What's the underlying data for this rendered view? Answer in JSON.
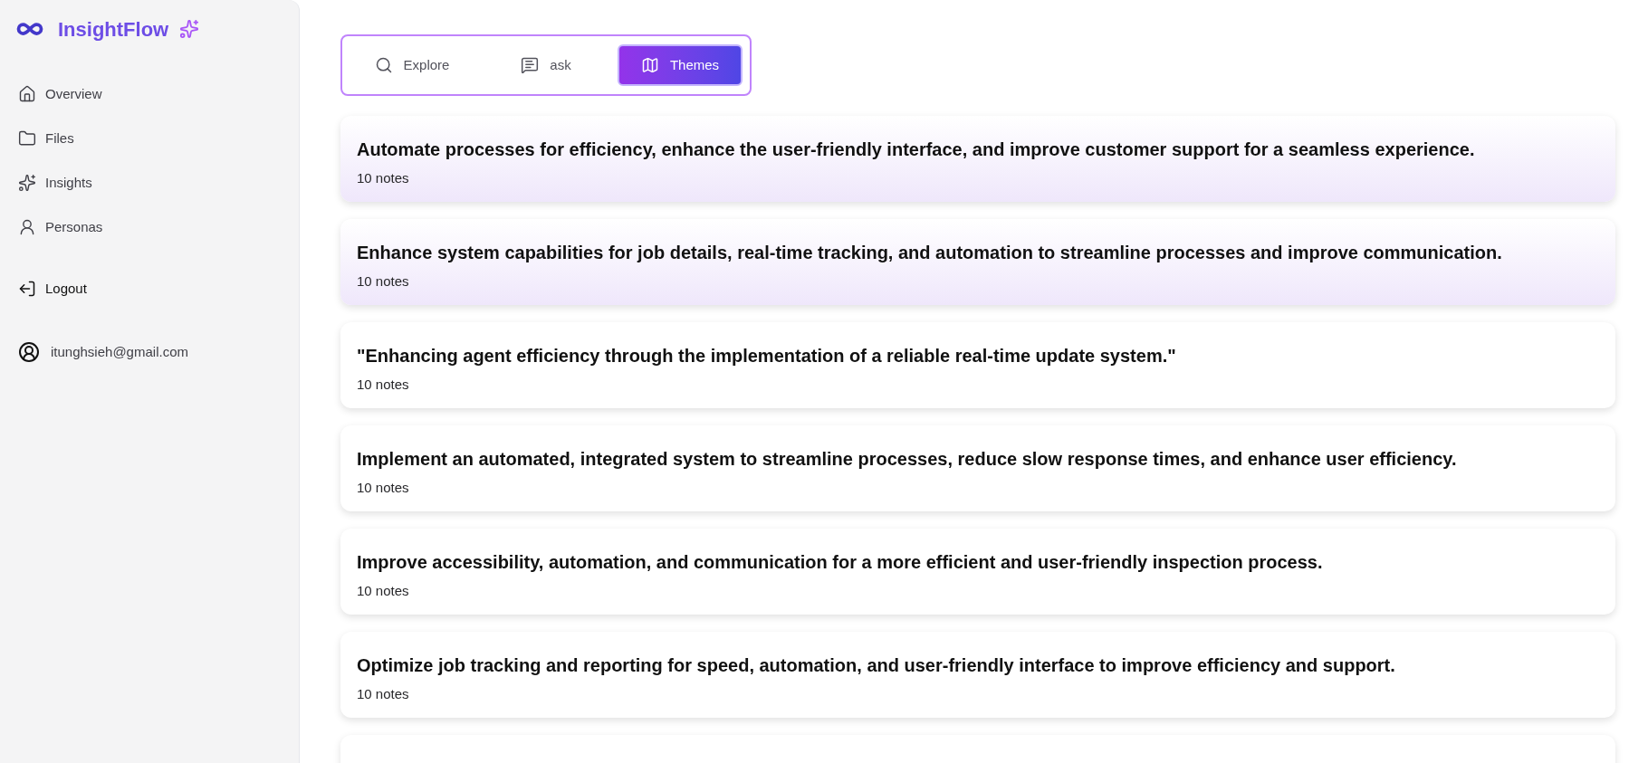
{
  "brand": {
    "name": "InsightFlow"
  },
  "sidebar": {
    "items": [
      {
        "label": "Overview"
      },
      {
        "label": "Files"
      },
      {
        "label": "Insights"
      },
      {
        "label": "Personas"
      }
    ],
    "logout": "Logout",
    "email": "itunghsieh@gmail.com"
  },
  "tabs": [
    {
      "label": "Explore",
      "selected": false
    },
    {
      "label": "ask",
      "selected": false
    },
    {
      "label": "Themes",
      "selected": true
    }
  ],
  "themes": [
    {
      "title": "Automate processes for efficiency, enhance the user-friendly interface, and improve customer support for a seamless experience.",
      "count": "10 notes",
      "highlighted": true
    },
    {
      "title": "Enhance system capabilities for job details, real-time tracking, and automation to streamline processes and improve communication.",
      "count": "10 notes",
      "highlighted": true
    },
    {
      "title": "\"Enhancing agent efficiency through the implementation of a reliable real-time update system.\"",
      "count": "10 notes",
      "highlighted": false
    },
    {
      "title": "Implement an automated, integrated system to streamline processes, reduce slow response times, and enhance user efficiency.",
      "count": "10 notes",
      "highlighted": false
    },
    {
      "title": "Improve accessibility, automation, and communication for a more efficient and user-friendly inspection process.",
      "count": "10 notes",
      "highlighted": false
    },
    {
      "title": "Optimize job tracking and reporting for speed, automation, and user-friendly interface to improve efficiency and support.",
      "count": "10 notes",
      "highlighted": false
    }
  ]
}
